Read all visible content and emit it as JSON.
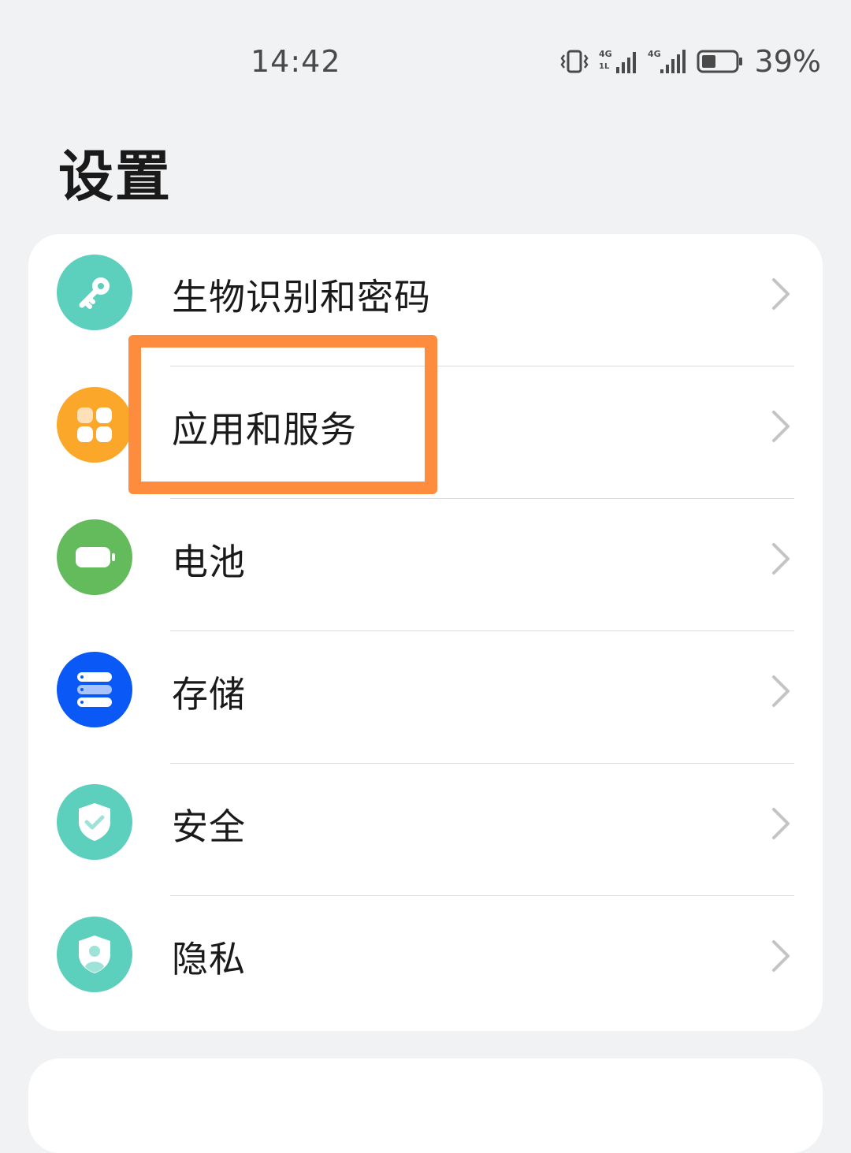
{
  "status_bar": {
    "time": "14:42",
    "battery_percent": "39%",
    "icons": [
      "vibrate-icon",
      "signal-4g-icon",
      "signal-4g-icon",
      "battery-icon"
    ]
  },
  "page": {
    "title": "设置"
  },
  "settings": {
    "items": [
      {
        "label": "生物识别和密码",
        "icon": "key-icon",
        "color": "#5dcfbd"
      },
      {
        "label": "应用和服务",
        "icon": "apps-grid-icon",
        "color": "#fba72a"
      },
      {
        "label": "电池",
        "icon": "battery-icon",
        "color": "#64bb5c"
      },
      {
        "label": "存储",
        "icon": "storage-icon",
        "color": "#0a59f7"
      },
      {
        "label": "安全",
        "icon": "shield-check-icon",
        "color": "#5dcfbd"
      },
      {
        "label": "隐私",
        "icon": "privacy-shield-icon",
        "color": "#5dcfbd"
      }
    ]
  },
  "highlight": {
    "color": "#fd8c3e",
    "target": "应用和服务"
  }
}
